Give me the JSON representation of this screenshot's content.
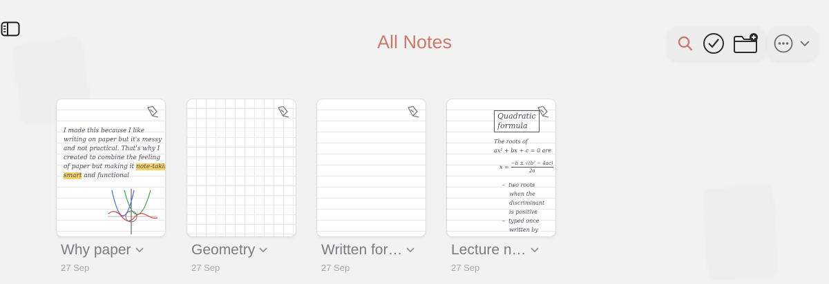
{
  "header": {
    "title": "All Notes"
  },
  "toolbar": {
    "search": "search-icon",
    "select": "checkmark-circle-icon",
    "new_folder": "folder-plus-icon",
    "more": "ellipsis-circle-icon"
  },
  "notes": [
    {
      "title": "Why paper",
      "date": "27 Sep",
      "paper": "lined",
      "text": "I made this because I like\nwriting on paper but it's messy\nand not practical. That's why I\ncreated to combine the feeling\nof paper but making it",
      "highlight_1": "note-taking",
      "highlight_2": "smart",
      "text_end": " and functional"
    },
    {
      "title": "Geometry",
      "date": "27 Sep",
      "paper": "grid"
    },
    {
      "title": "Written for…",
      "date": "27 Sep",
      "paper": "lined"
    },
    {
      "title": "Lecture n…",
      "date": "27 Sep",
      "paper": "lined",
      "heading_1": "Quadratic",
      "heading_2": "formula",
      "intro": "The roots of\nax² + bx + c = 0 are",
      "formula_num": "−b ± √(b² − 4ac)",
      "formula_den": "2a",
      "formula_lhs": "x =",
      "bullets": "–  two roots\n    when the\n    discriminant\n    is positive\n–  typed once\n    written by"
    }
  ],
  "colors": {
    "accent": "#c97a6e",
    "highlight": "#f7d26a"
  }
}
